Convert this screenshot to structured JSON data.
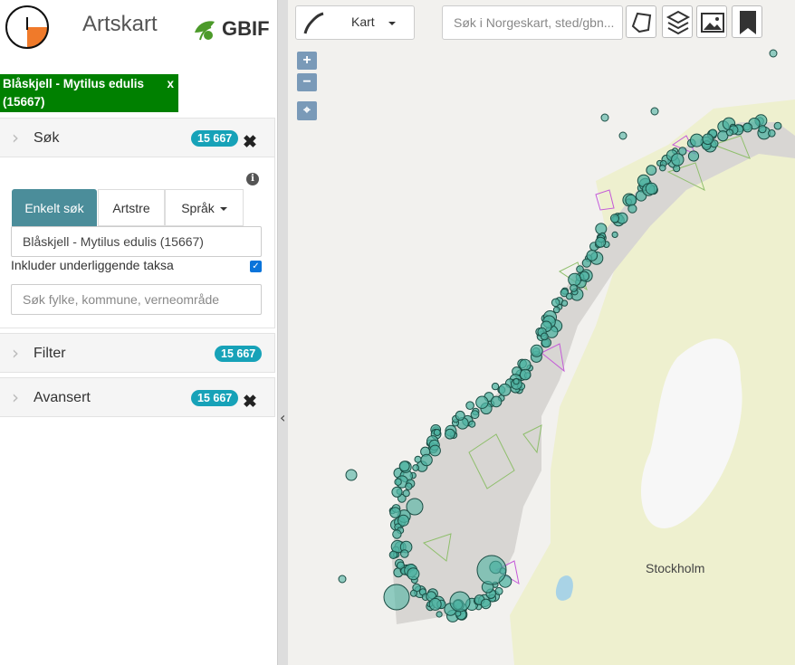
{
  "header": {
    "app_title": "Artskart",
    "partner_logo_text": "GBIF"
  },
  "selected_species": {
    "label": "Blåskjell - Mytilus edulis (15667)",
    "close_label": "x"
  },
  "panels": {
    "sok": {
      "title": "Søk",
      "count": "15 667"
    },
    "filter": {
      "title": "Filter",
      "count": "15 667"
    },
    "avansert": {
      "title": "Avansert",
      "count": "15 667"
    }
  },
  "search": {
    "tabs": [
      "Enkelt søk",
      "Artstre",
      "Språk"
    ],
    "active_tab": "Enkelt søk",
    "species_value": "Blåskjell - Mytilus edulis (15667)",
    "include_label": "Inkluder underliggende taksa",
    "include_checked": true,
    "area_placeholder": "Søk fylke, kommune, verneområde"
  },
  "map": {
    "basemap_label": "Kart",
    "search_placeholder": "Søk i Norgeskart, sted/gbn...",
    "zoom_in": "+",
    "zoom_out": "−",
    "city_label": "Stockholm",
    "colors": {
      "occurrence_fill": "#4fb3a1",
      "occurrence_stroke": "#1b4d44",
      "species_tag": "#008000",
      "badge": "#17a2b8",
      "active_tab": "#4b8d9a"
    }
  },
  "icons": [
    "logo-icon",
    "gbif-leaf-icon",
    "chevron-right-icon",
    "close-icon",
    "info-icon",
    "caret-down-icon",
    "checkbox-icon",
    "collapse-arrow-icon",
    "norway-map-icon",
    "polygon-draw-icon",
    "layers-icon",
    "image-icon",
    "bookmark-icon",
    "locate-icon"
  ]
}
